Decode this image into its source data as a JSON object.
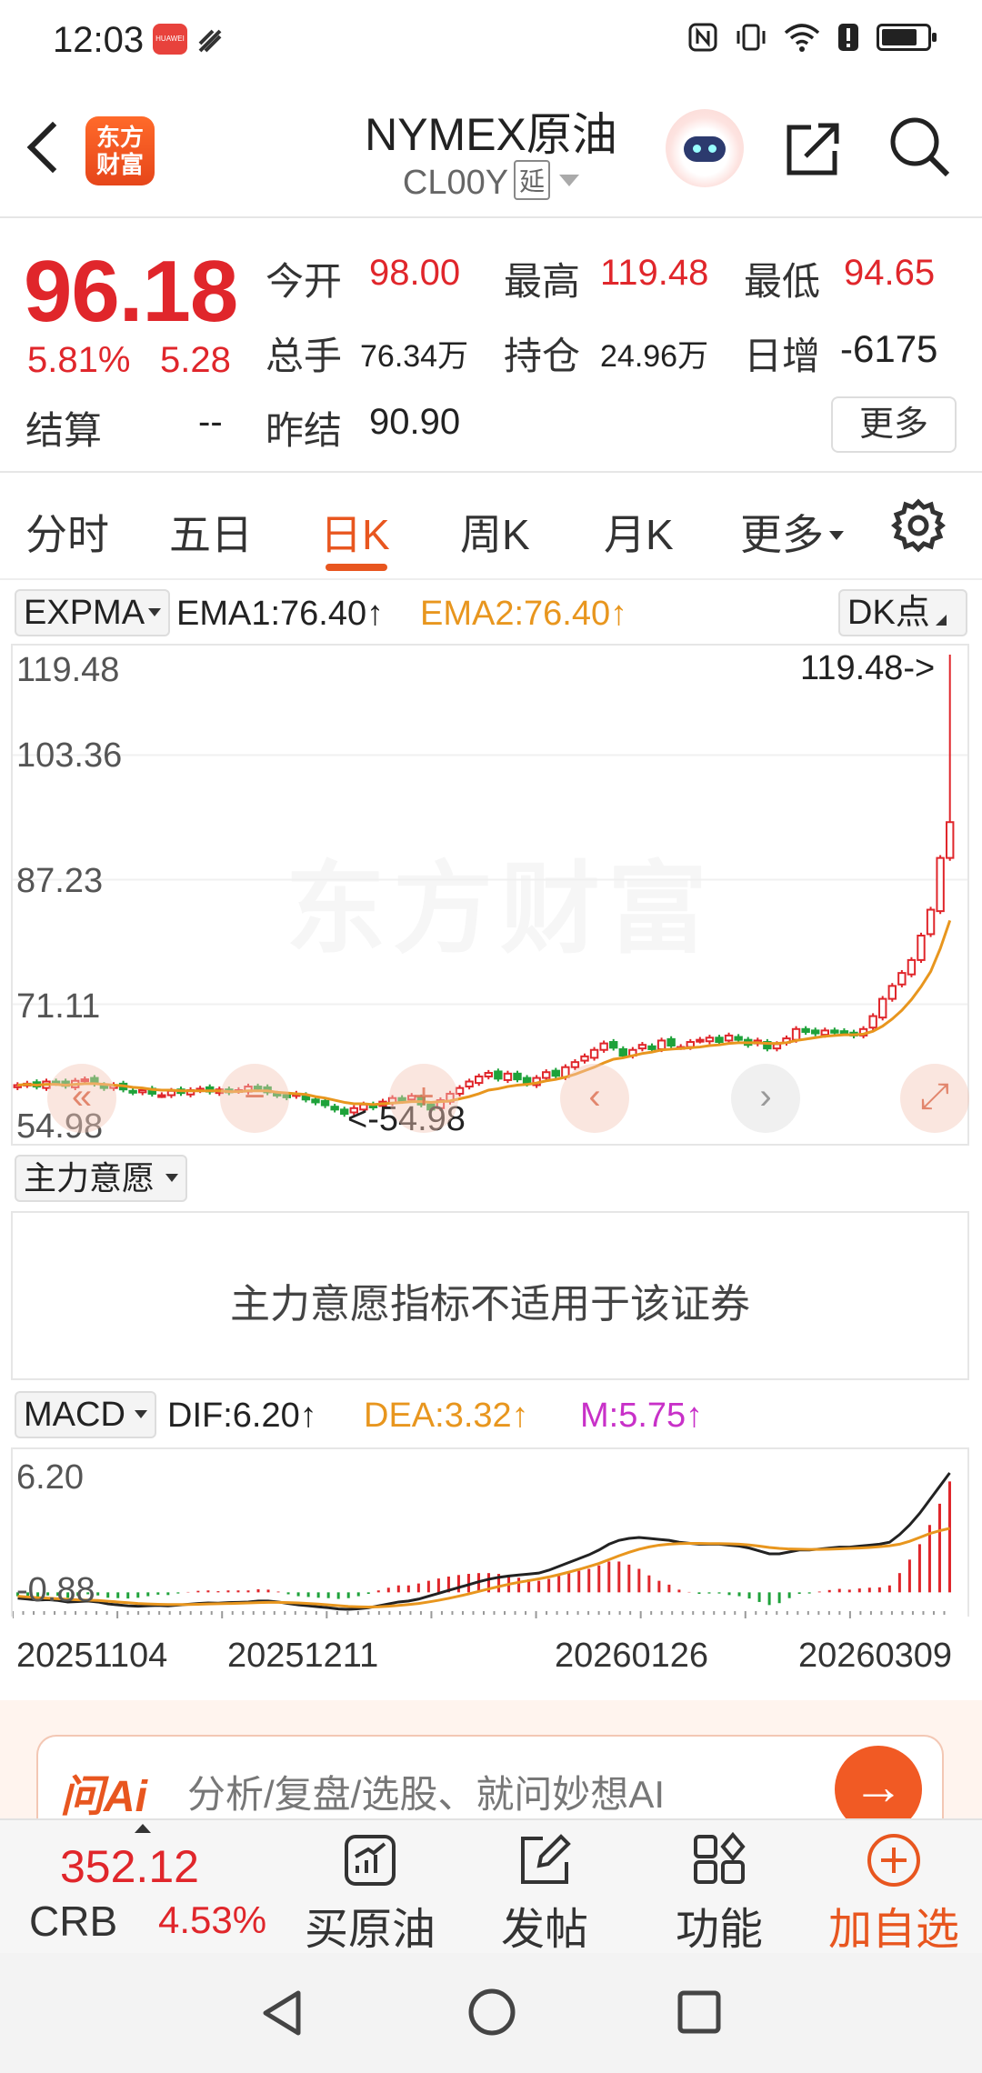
{
  "status": {
    "time": "12:03",
    "badge": "HUAWEI",
    "battery_level": 0.7
  },
  "header": {
    "title": "NYMEX原油",
    "code": "CL00Y",
    "delay_tag": "延",
    "logo_text": "东方\n财富"
  },
  "quote": {
    "price": "96.18",
    "pct": "5.81%",
    "change": "5.28",
    "open_label": "今开",
    "open": "98.00",
    "high_label": "最高",
    "high": "119.48",
    "low_label": "最低",
    "low": "94.65",
    "volume_label": "总手",
    "volume": "76.34万",
    "oi_label": "持仓",
    "oi": "24.96万",
    "daily_inc_label": "日增",
    "daily_inc": "-6175",
    "settle_label": "结算",
    "settle": "--",
    "prev_settle_label": "昨结",
    "prev_settle": "90.90",
    "more_label": "更多"
  },
  "tabs": [
    {
      "label": "分时",
      "active": false
    },
    {
      "label": "五日",
      "active": false
    },
    {
      "label": "日K",
      "active": true
    },
    {
      "label": "周K",
      "active": false
    },
    {
      "label": "月K",
      "active": false
    },
    {
      "label": "更多",
      "active": false
    }
  ],
  "indicators": {
    "main_selector": "EXPMA",
    "ema1": "EMA1:76.40↑",
    "ema2": "EMA2:76.40↑",
    "dk_label": "DK点",
    "sub_selector": "主力意愿",
    "sub_message": "主力意愿指标不适用于该证券",
    "macd_selector": "MACD",
    "dif": "DIF:6.20↑",
    "dea": "DEA:3.32↑",
    "m": "M:5.75↑"
  },
  "colors": {
    "up": "#e0262b",
    "down": "#1ea23a",
    "ema1": "#222222",
    "ema2": "#e8961e",
    "m": "#c831c8",
    "accent": "#e8561f"
  },
  "chart": {
    "watermark": "东方财富",
    "y_ticks": [
      "119.48",
      "103.36",
      "87.23",
      "71.11",
      "54.98"
    ],
    "max_marker": "119.48->",
    "min_marker": "<-54.98",
    "macd_y_ticks": [
      "6.20",
      "-0.88"
    ],
    "dates": [
      "20251104",
      "20251211",
      "20260126",
      "20260309"
    ]
  },
  "chart_data": {
    "type": "candlestick",
    "ylim": [
      54.98,
      119.48
    ],
    "closes": [
      59.6,
      59.8,
      59.4,
      60.1,
      59.9,
      59.5,
      60.2,
      60.4,
      59.8,
      59.2,
      59.6,
      59.0,
      58.6,
      58.9,
      58.4,
      58.2,
      58.8,
      58.5,
      58.9,
      59.1,
      58.7,
      59.0,
      58.6,
      58.9,
      59.4,
      59.1,
      58.6,
      58.2,
      57.9,
      58.4,
      57.6,
      57.2,
      56.8,
      56.2,
      55.6,
      56.4,
      56.9,
      56.5,
      57.3,
      57.8,
      57.4,
      58.1,
      56.9,
      56.2,
      57.5,
      58.4,
      59.2,
      60.1,
      60.8,
      61.3,
      60.5,
      61.2,
      60.4,
      59.8,
      60.6,
      61.4,
      60.9,
      62.1,
      62.8,
      63.6,
      64.5,
      65.4,
      64.8,
      63.7,
      64.5,
      65.2,
      64.6,
      65.8,
      65.1,
      64.9,
      65.6,
      65.9,
      66.2,
      65.6,
      66.5,
      65.9,
      65.2,
      65.8,
      64.7,
      65.3,
      66.1,
      67.4,
      67.0,
      66.8,
      67.2,
      66.9,
      67.1,
      66.5,
      67.4,
      69.2,
      71.6,
      73.4,
      75.2,
      77.0,
      80.4,
      84.0,
      91.2,
      96.18
    ],
    "ema2": [
      59.6,
      59.7,
      59.6,
      59.7,
      59.7,
      59.6,
      59.7,
      59.8,
      59.8,
      59.7,
      59.6,
      59.5,
      59.3,
      59.2,
      59.0,
      58.9,
      58.9,
      58.8,
      58.8,
      58.8,
      58.8,
      58.8,
      58.7,
      58.7,
      58.8,
      58.8,
      58.8,
      58.6,
      58.5,
      58.4,
      58.3,
      58.0,
      57.8,
      57.5,
      57.2,
      57.0,
      57.0,
      56.9,
      57.0,
      57.1,
      57.2,
      57.3,
      57.3,
      57.2,
      57.3,
      57.4,
      57.7,
      58.0,
      58.4,
      58.9,
      59.1,
      59.4,
      59.6,
      59.7,
      59.9,
      60.2,
      60.4,
      60.7,
      61.1,
      61.6,
      62.1,
      62.7,
      63.2,
      63.4,
      63.7,
      64.0,
      64.2,
      64.5,
      64.6,
      64.7,
      64.8,
      64.9,
      65.1,
      65.2,
      65.4,
      65.5,
      65.5,
      65.5,
      65.4,
      65.4,
      65.5,
      65.8,
      66.0,
      66.2,
      66.4,
      66.5,
      66.6,
      66.6,
      66.7,
      67.1,
      67.8,
      68.8,
      70.0,
      71.5,
      73.3,
      75.4,
      78.6,
      82.5
    ],
    "macd_dif": [
      -0.3,
      -0.35,
      -0.4,
      -0.38,
      -0.42,
      -0.5,
      -0.48,
      -0.45,
      -0.5,
      -0.6,
      -0.65,
      -0.7,
      -0.72,
      -0.7,
      -0.68,
      -0.7,
      -0.66,
      -0.62,
      -0.58,
      -0.55,
      -0.56,
      -0.53,
      -0.52,
      -0.5,
      -0.45,
      -0.45,
      -0.5,
      -0.58,
      -0.65,
      -0.7,
      -0.75,
      -0.8,
      -0.86,
      -0.88,
      -0.85,
      -0.8,
      -0.7,
      -0.6,
      -0.5,
      -0.45,
      -0.35,
      -0.2,
      -0.05,
      0.1,
      0.25,
      0.4,
      0.55,
      0.68,
      0.78,
      0.85,
      0.9,
      0.95,
      1.0,
      1.15,
      1.35,
      1.55,
      1.75,
      1.95,
      2.2,
      2.5,
      2.7,
      2.8,
      2.85,
      2.8,
      2.75,
      2.7,
      2.6,
      2.55,
      2.5,
      2.5,
      2.5,
      2.45,
      2.4,
      2.3,
      2.15,
      2.0,
      2.0,
      2.1,
      2.2,
      2.2,
      2.25,
      2.3,
      2.35,
      2.35,
      2.4,
      2.45,
      2.5,
      2.6,
      3.0,
      3.5,
      4.1,
      4.8,
      5.5,
      6.2
    ],
    "macd_dea": [
      -0.2,
      -0.24,
      -0.28,
      -0.3,
      -0.33,
      -0.36,
      -0.39,
      -0.4,
      -0.42,
      -0.46,
      -0.5,
      -0.54,
      -0.58,
      -0.6,
      -0.62,
      -0.63,
      -0.63,
      -0.63,
      -0.62,
      -0.6,
      -0.59,
      -0.58,
      -0.57,
      -0.55,
      -0.53,
      -0.52,
      -0.52,
      -0.53,
      -0.55,
      -0.58,
      -0.61,
      -0.65,
      -0.69,
      -0.73,
      -0.75,
      -0.76,
      -0.75,
      -0.72,
      -0.68,
      -0.63,
      -0.58,
      -0.5,
      -0.41,
      -0.31,
      -0.2,
      -0.08,
      0.05,
      0.18,
      0.3,
      0.42,
      0.52,
      0.61,
      0.7,
      0.8,
      0.92,
      1.05,
      1.19,
      1.34,
      1.5,
      1.7,
      1.9,
      2.08,
      2.24,
      2.36,
      2.45,
      2.5,
      2.53,
      2.54,
      2.54,
      2.53,
      2.53,
      2.52,
      2.5,
      2.46,
      2.4,
      2.33,
      2.28,
      2.25,
      2.24,
      2.23,
      2.23,
      2.24,
      2.26,
      2.28,
      2.3,
      2.33,
      2.37,
      2.42,
      2.5,
      2.65,
      2.85,
      3.05,
      3.2,
      3.32
    ]
  },
  "promo": {
    "logo": "问Ai",
    "text": "分析/复盘/选股、就问妙想AI"
  },
  "bottom": {
    "crb_value": "352.12",
    "crb_name": "CRB",
    "crb_pct": "4.53%",
    "items": [
      "买原油",
      "发帖",
      "功能",
      "加自选"
    ]
  }
}
